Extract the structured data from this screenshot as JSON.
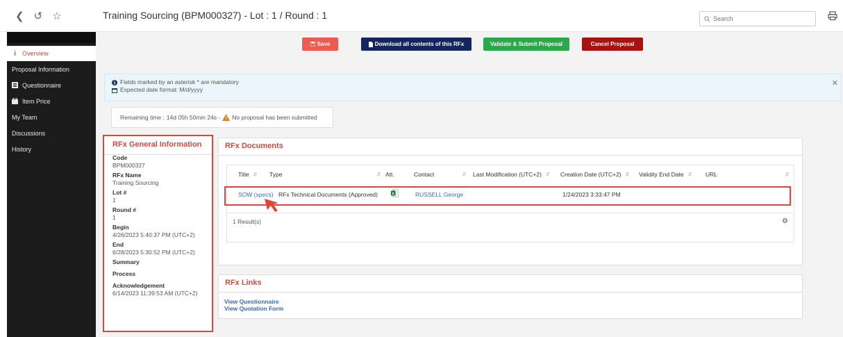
{
  "header": {
    "title": "Training Sourcing (BPM000327) - Lot : 1 / Round : 1",
    "search_placeholder": "Search"
  },
  "sidebar": {
    "items": [
      {
        "label": "Overview",
        "icon": "info-icon",
        "active": true
      },
      {
        "label": "Proposal Information",
        "icon": "",
        "active": false
      },
      {
        "label": "Questionnaire",
        "icon": "list-icon",
        "active": false
      },
      {
        "label": "Item Price",
        "icon": "box-icon",
        "active": false
      },
      {
        "label": "My Team",
        "icon": "",
        "active": false
      },
      {
        "label": "Discussions",
        "icon": "",
        "active": false
      },
      {
        "label": "History",
        "icon": "",
        "active": false
      }
    ]
  },
  "toolbar": {
    "save_label": "Save",
    "download_label": "Download all contents of this RFx",
    "validate_label": "Validate & Submit Proposal",
    "cancel_label": "Cancel Proposal"
  },
  "info": {
    "mandatory": "Fields marked by an asterisk * are mandatory",
    "date_format": "Expected date format: M/d/yyyy"
  },
  "remaining": {
    "prefix": "Remaining time :",
    "time": "14d 05h 50min 24s -",
    "warning": "No proposal has been submitted"
  },
  "general": {
    "title": "RFx General Information",
    "fields": [
      {
        "label": "Code",
        "value": "BPM000327"
      },
      {
        "label": "RFx Name",
        "value": "Training Sourcing"
      },
      {
        "label": "Lot #",
        "value": "1"
      },
      {
        "label": "Round #",
        "value": "1"
      },
      {
        "label": "Begin",
        "value": "4/26/2023 5:40:37 PM (UTC+2)"
      },
      {
        "label": "End",
        "value": "6/28/2023 5:30:52 PM (UTC+2)"
      },
      {
        "label": "Summary",
        "value": ""
      },
      {
        "label": "Process",
        "value": ""
      },
      {
        "label": "Acknowledgement",
        "value": "6/14/2023 11:39:53 AM (UTC+2)"
      }
    ]
  },
  "documents": {
    "title": "RFx Documents",
    "columns": [
      "Title",
      "Type",
      "Att.",
      "Contact",
      "Last Modification (UTC+2)",
      "Creation Date (UTC+2)",
      "Validity End Date",
      "URL"
    ],
    "rows": [
      {
        "title": "SOW (specs)",
        "type": "RFx Technical Documents (Approved)",
        "att": "excel-file-icon",
        "contact": "RUSSELL George",
        "last_modification": "",
        "creation_date": "1/24/2023 3:33:47 PM",
        "validity_end": "",
        "url": ""
      }
    ],
    "result_count": "1 Result(s)"
  },
  "links": {
    "title": "RFx Links",
    "items": [
      "View Questionnaire",
      "View Quotation Form"
    ]
  },
  "colors": {
    "accent": "#e0453a",
    "save": "#ee5b53",
    "download": "#14265e",
    "validate": "#2ba84a",
    "cancel": "#a8130f",
    "link": "#3b68b5"
  }
}
